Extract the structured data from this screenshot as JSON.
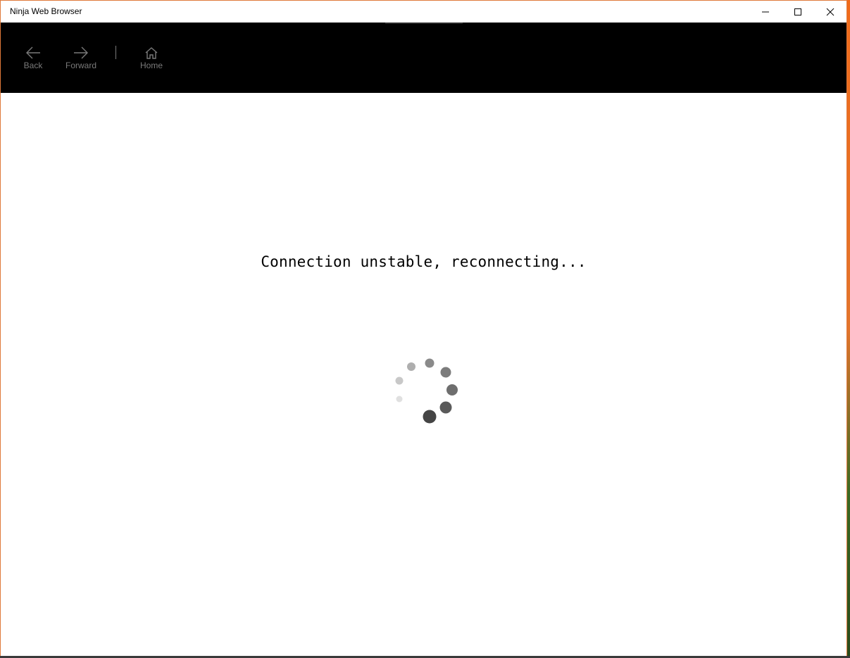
{
  "window": {
    "title": "Ninja Web Browser",
    "accent_border": "#e0793a"
  },
  "caption_buttons": {
    "minimize": "minimize-icon",
    "maximize": "maximize-icon",
    "close": "close-icon"
  },
  "appbar": {
    "background": "#000000",
    "back": {
      "label": "Back",
      "icon": "arrow-left-icon"
    },
    "forward": {
      "label": "Forward",
      "icon": "arrow-right-icon"
    },
    "home": {
      "label": "Home",
      "icon": "home-icon"
    }
  },
  "main": {
    "status_message": "Connection unstable, reconnecting...",
    "spinner_icon": "loading-spinner-icon"
  }
}
